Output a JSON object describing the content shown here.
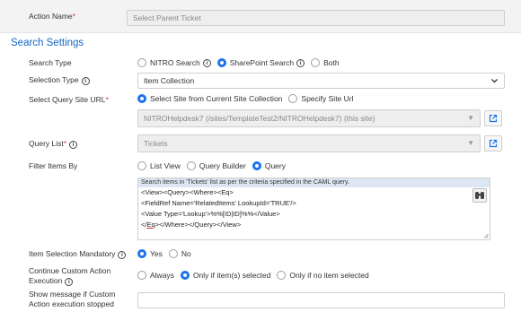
{
  "top": {
    "action_name_label": "Action Name",
    "required_mark": "*",
    "action_name_placeholder": "Select Parent Ticket"
  },
  "search_settings": {
    "title": "Search Settings",
    "search_type": {
      "label": "Search Type",
      "options": [
        "NITRO Search",
        "SharePoint Search",
        "Both"
      ],
      "selected": "SharePoint Search"
    },
    "selection_type": {
      "label": "Selection Type",
      "value": "Item Collection"
    },
    "query_site_url": {
      "label": "Select Query Site URL",
      "options": [
        "Select Site from Current Site Collection",
        "Specify Site Url"
      ],
      "selected": "Select Site from Current Site Collection",
      "site_value": "NITROHelpdesk7 (/sites/TemplateTest2/NITROHelpdesk7) (this site)"
    },
    "query_list": {
      "label": "Query List",
      "value": "Tickets"
    },
    "filter_items_by": {
      "label": "Filter Items By",
      "options": [
        "List View",
        "Query Builder",
        "Query"
      ],
      "selected": "Query",
      "query_hint": "Search items in 'Tickets' list as per the criteria specified in the CAML query.",
      "query_lines": {
        "l1": "<View><Query><Where><Eq>",
        "l2": "<FieldRef Name='RelatedItems' LookupId='TRUE'/>",
        "l3": "<Value Type='Lookup'>%%[ID|ID]%%</Value>",
        "l4_pre": "</",
        "l4_eq": "Eq",
        "l4_post": "></Where></Query></View>"
      }
    },
    "item_selection_mandatory": {
      "label": "Item Selection Mandatory",
      "options": [
        "Yes",
        "No"
      ],
      "selected": "Yes"
    },
    "continue_custom_action": {
      "label_line1": "Continue Custom Action",
      "label_line2": "Execution",
      "options": [
        "Always",
        "Only if item(s) selected",
        "Only if no item selected"
      ],
      "selected": "Only if item(s) selected"
    },
    "show_message": {
      "label_line1": "Show message if Custom",
      "label_line2": "Action execution stopped",
      "value": ""
    }
  },
  "colors": {
    "accent": "#1a73e8",
    "section_title": "#1565c0",
    "required": "#d32f2f",
    "query_header_bg": "#dde7f3"
  },
  "icons": {
    "info": "info-icon",
    "link": "link-icon",
    "dropdown": "chevron-down-icon",
    "search": "binoculars-icon"
  }
}
